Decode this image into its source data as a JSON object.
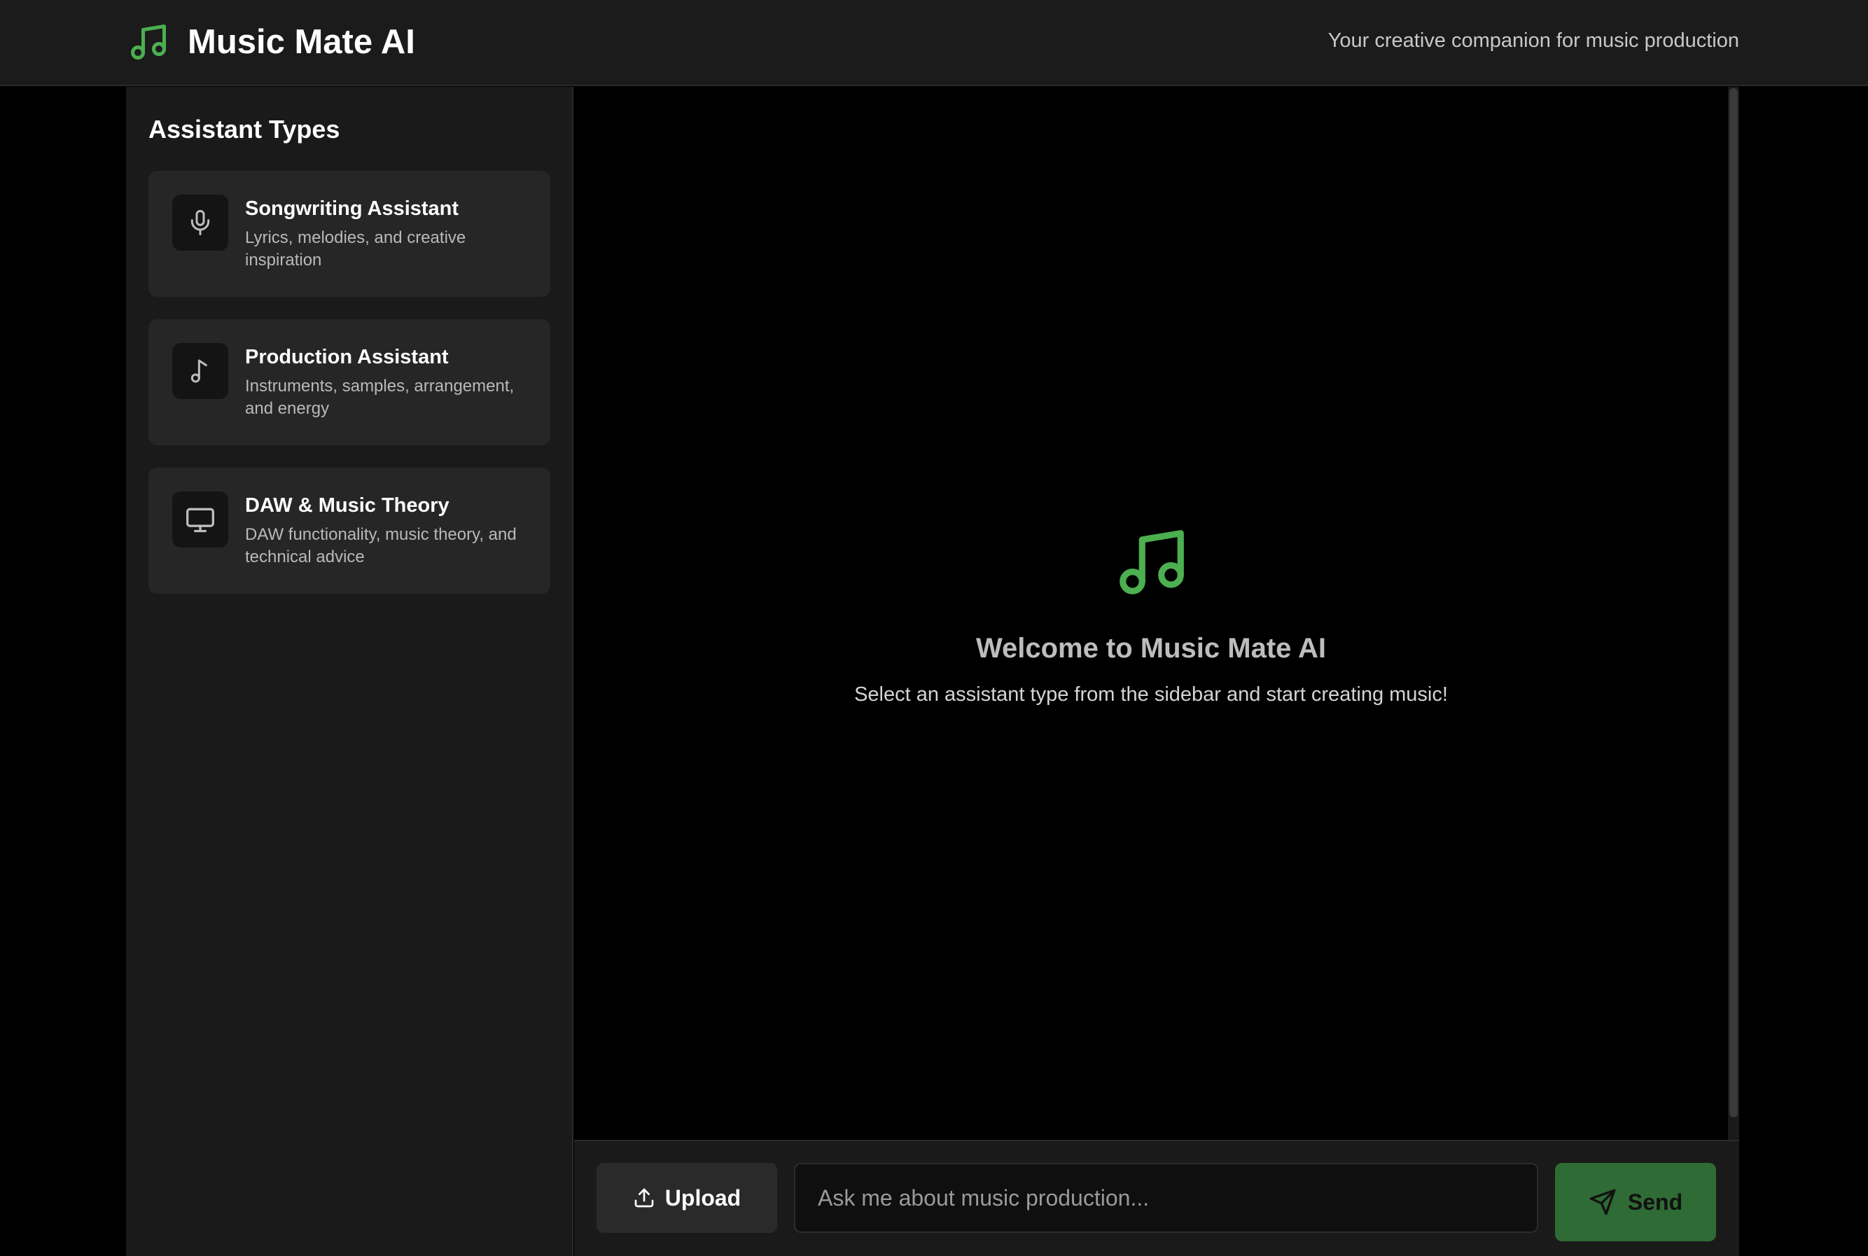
{
  "header": {
    "app_title": "Music Mate AI",
    "tagline": "Your creative companion for music production",
    "logo_icon": "music-note-icon"
  },
  "sidebar": {
    "title": "Assistant Types",
    "items": [
      {
        "title": "Songwriting Assistant",
        "description": "Lyrics, melodies, and creative inspiration",
        "icon": "microphone-icon"
      },
      {
        "title": "Production Assistant",
        "description": "Instruments, samples, arrangement, and energy",
        "icon": "music-note-icon"
      },
      {
        "title": "DAW & Music Theory",
        "description": "DAW functionality, music theory, and technical advice",
        "icon": "monitor-icon"
      }
    ]
  },
  "main": {
    "welcome_title": "Welcome to Music Mate AI",
    "welcome_subtitle": "Select an assistant type from the sidebar and start creating music!",
    "welcome_icon": "music-note-icon"
  },
  "composer": {
    "upload_label": "Upload",
    "input_placeholder": "Ask me about music production...",
    "input_value": "",
    "send_label": "Send"
  },
  "colors": {
    "accent_green": "#4caf50",
    "send_button": "#2f6b34",
    "panel_bg": "#1a1a1a",
    "card_bg": "#262626"
  }
}
